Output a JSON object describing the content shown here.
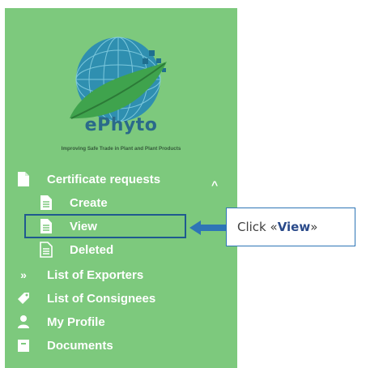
{
  "brand": {
    "name": "ePhyto",
    "tagline": "Improving Safe Trade in Plant and Plant Products"
  },
  "sidebar": {
    "sections": [
      {
        "label": "Certificate requests",
        "icon": "document-icon",
        "expanded": true,
        "children": [
          {
            "label": "Create",
            "icon": "file-text-icon"
          },
          {
            "label": "View",
            "icon": "file-text-icon",
            "highlighted": true
          },
          {
            "label": "Deleted",
            "icon": "file-text-icon"
          }
        ]
      },
      {
        "label": "List of Exporters",
        "icon": "double-chevron-right-icon"
      },
      {
        "label": "List of Consignees",
        "icon": "tag-icon"
      },
      {
        "label": "My Profile",
        "icon": "user-icon"
      },
      {
        "label": "Documents",
        "icon": "archive-icon"
      }
    ]
  },
  "callout": {
    "prefix": "Click «",
    "target": "View",
    "suffix": "»"
  },
  "colors": {
    "sidebar_bg": "#7dc97d",
    "highlight_border": "#1f5a8f",
    "arrow": "#2e75b6"
  }
}
